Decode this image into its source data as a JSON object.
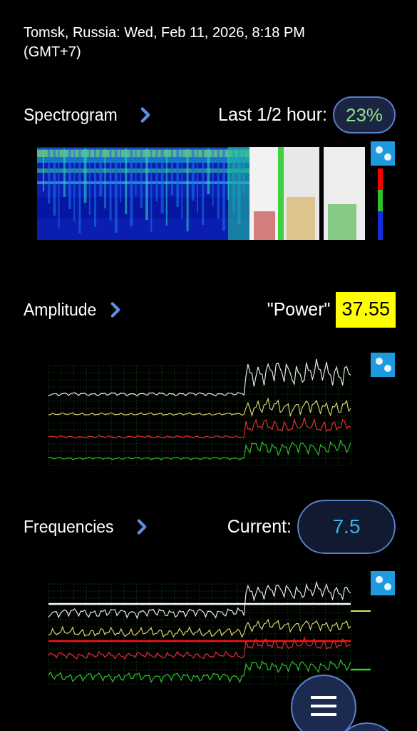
{
  "header": {
    "location_time": "Tomsk, Russia: Wed, Feb 11, 2026, 8:18 PM",
    "timezone": "(GMT+7)"
  },
  "sections": [
    {
      "kind": "spectrogram",
      "title": "Spectrogram",
      "reading_label": "Last 1/2 hour:",
      "reading": "23%"
    },
    {
      "kind": "amplitude",
      "title": "Amplitude",
      "reading_label": "\"Power\"",
      "reading": "37.55"
    },
    {
      "kind": "frequencies",
      "title": "Frequencies",
      "reading_label": "Current:",
      "reading": "7.5"
    }
  ]
}
